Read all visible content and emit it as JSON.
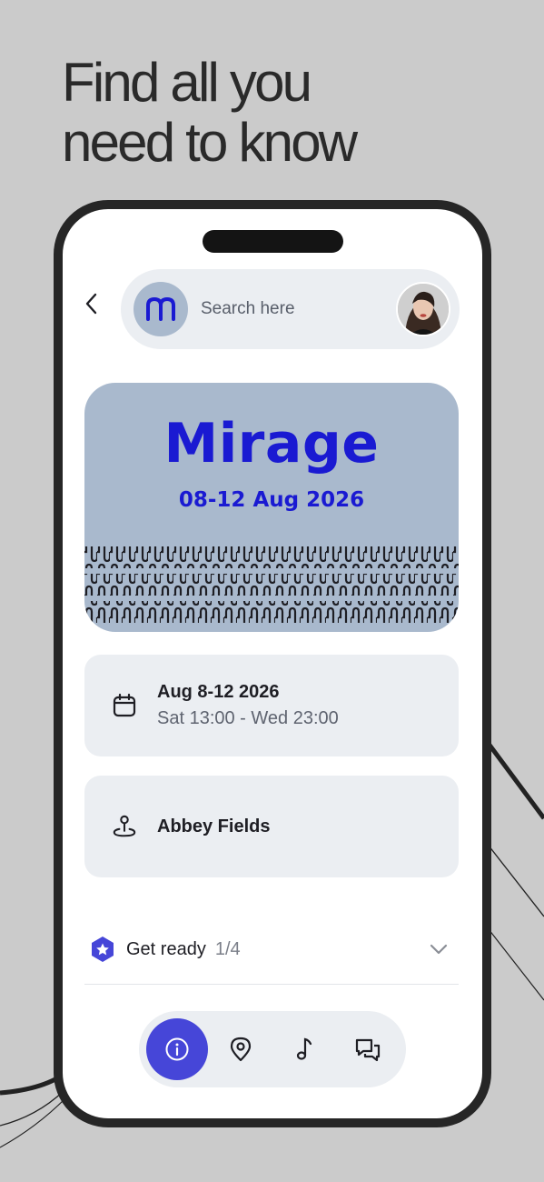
{
  "headline": {
    "line1": "Find all you",
    "line2": "need to know"
  },
  "search": {
    "placeholder": "Search here"
  },
  "banner": {
    "title": "Mirage",
    "date": "08-12 Aug 2026"
  },
  "event_card": {
    "title": "Aug 8-12 2026",
    "subtitle": "Sat 13:00 - Wed 23:00"
  },
  "location_card": {
    "title": "Abbey Fields"
  },
  "get_ready": {
    "label": "Get ready",
    "progress": "1/4"
  },
  "tabs": [
    "info-icon",
    "location-pin-icon",
    "music-note-icon",
    "chat-icon"
  ],
  "colors": {
    "accent": "#4646d8",
    "brand_blue": "#1a1ad2",
    "banner_bg": "#a9b9cd",
    "card_bg": "#ebeef2",
    "page_bg": "#cbcbcb"
  }
}
